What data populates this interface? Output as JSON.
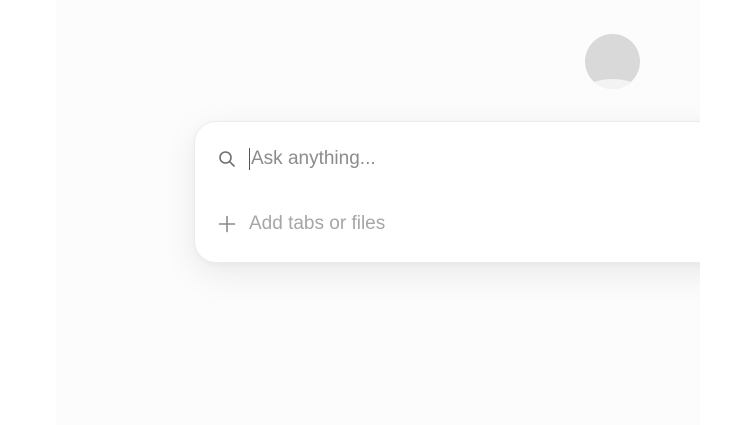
{
  "search": {
    "placeholder": "Ask anything...",
    "icon": "search-icon"
  },
  "attach": {
    "label": "Add tabs or files",
    "icon": "plus-icon"
  },
  "colors": {
    "card_bg": "#ffffff",
    "avatar": "#d9d9d9",
    "placeholder": "#8c8c8c",
    "secondary_text": "#a6a6a6"
  }
}
